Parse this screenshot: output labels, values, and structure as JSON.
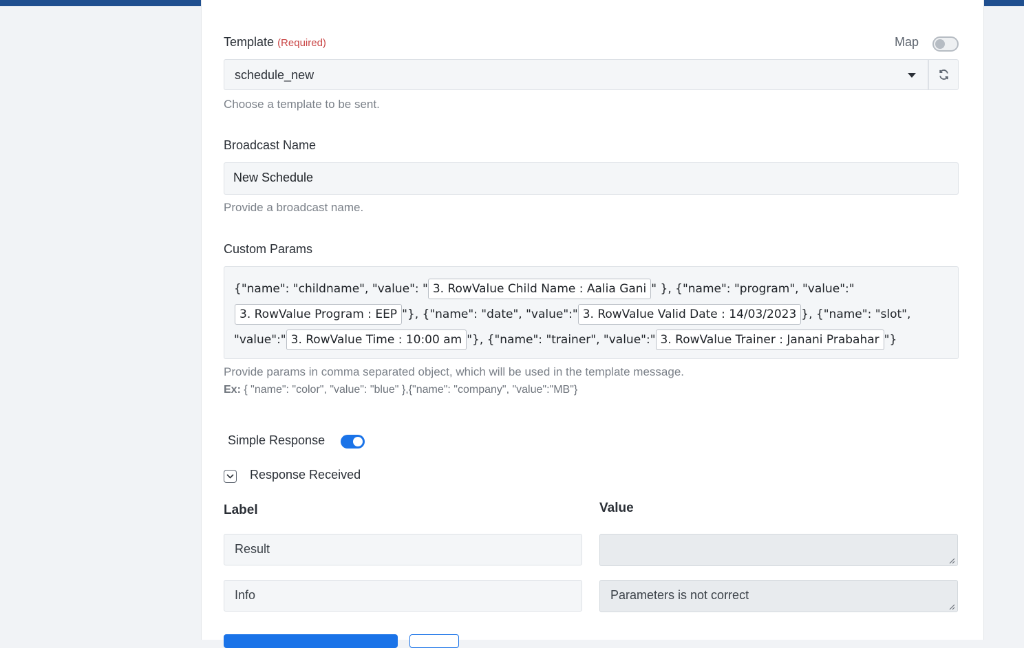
{
  "template": {
    "label": "Template",
    "required": "(Required)",
    "map_label": "Map",
    "selected": "schedule_new",
    "help": "Choose a template to be sent."
  },
  "broadcast": {
    "label": "Broadcast Name",
    "value": "New Schedule",
    "help": "Provide a broadcast name."
  },
  "custom_params": {
    "label": "Custom Params",
    "t1": "{\"name\": \"childname\", \"value\": \"",
    "p1": "3. RowValue Child Name : Aalia Gani",
    "t2": "\" }, {\"name\": \"program\", \"value\":\"",
    "p2": "3. RowValue Program : EEP",
    "t3": "\"}, {\"name\": \"date\", \"value\":\"",
    "p3": "3. RowValue Valid Date : 14/03/2023",
    "t4": "}, {\"name\": \"slot\",",
    "t5": "\"value\":\"",
    "p4": "3. RowValue Time : 10:00 am",
    "t6": "\"}, {\"name\": \"trainer\", \"value\":\"",
    "p5": "3. RowValue Trainer : Janani Prabahar",
    "t7": "\"}",
    "help": "Provide params in comma separated object, which will be used in the template message.",
    "ex_label": "Ex:",
    "ex_value": " { \"name\": \"color\", \"value\": \"blue\" },{\"name\": \"company\", \"value\":\"MB\"}"
  },
  "simple_response": {
    "label": "Simple Response",
    "enabled": true
  },
  "response_received": {
    "label": "Response Received",
    "label_header": "Label",
    "value_header": "Value",
    "rows": [
      {
        "label": "Result",
        "value": ""
      },
      {
        "label": "Info",
        "value": "Parameters is not correct"
      }
    ]
  },
  "colors": {
    "accent": "#1a73e8",
    "required": "#c94545",
    "topbar": "#1f4f8f"
  },
  "icons": [
    "refresh-icon",
    "caret-down-icon",
    "chevron-down-icon",
    "resize-grip-icon"
  ]
}
